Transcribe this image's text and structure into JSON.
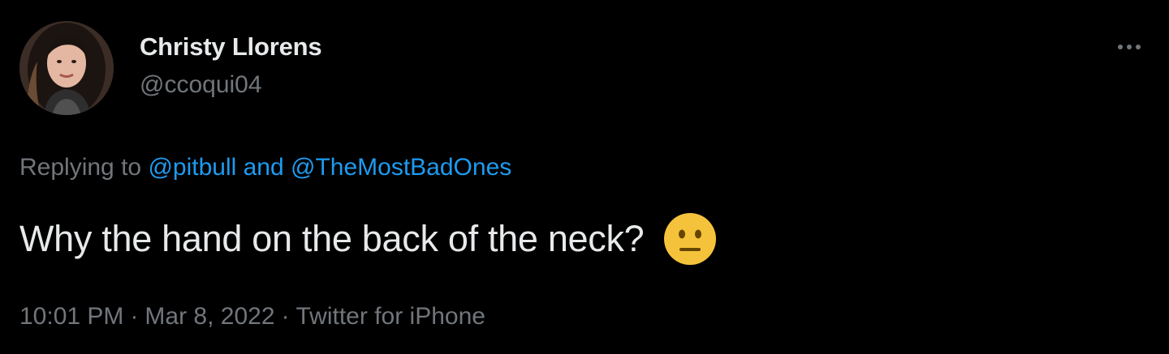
{
  "author": {
    "name": "Christy Llorens",
    "handle": "@ccoqui04"
  },
  "more_icon": "more-horizontal-icon",
  "reply": {
    "prefix": "Replying to ",
    "mention1": "@pitbull",
    "joiner": " and ",
    "mention2": "@TheMostBadOnes"
  },
  "tweet": {
    "text": "Why the hand on the back of the neck?",
    "emoji": "neutral-face-emoji"
  },
  "meta": {
    "time": "10:01 PM",
    "sep1": "·",
    "date": "Mar 8, 2022",
    "sep2": "·",
    "source": "Twitter for iPhone"
  },
  "colors": {
    "background": "#000000",
    "primary_text": "#e7e9ea",
    "secondary_text": "#71767b",
    "link": "#1d9bf0",
    "emoji_face": "#f5c33b"
  }
}
